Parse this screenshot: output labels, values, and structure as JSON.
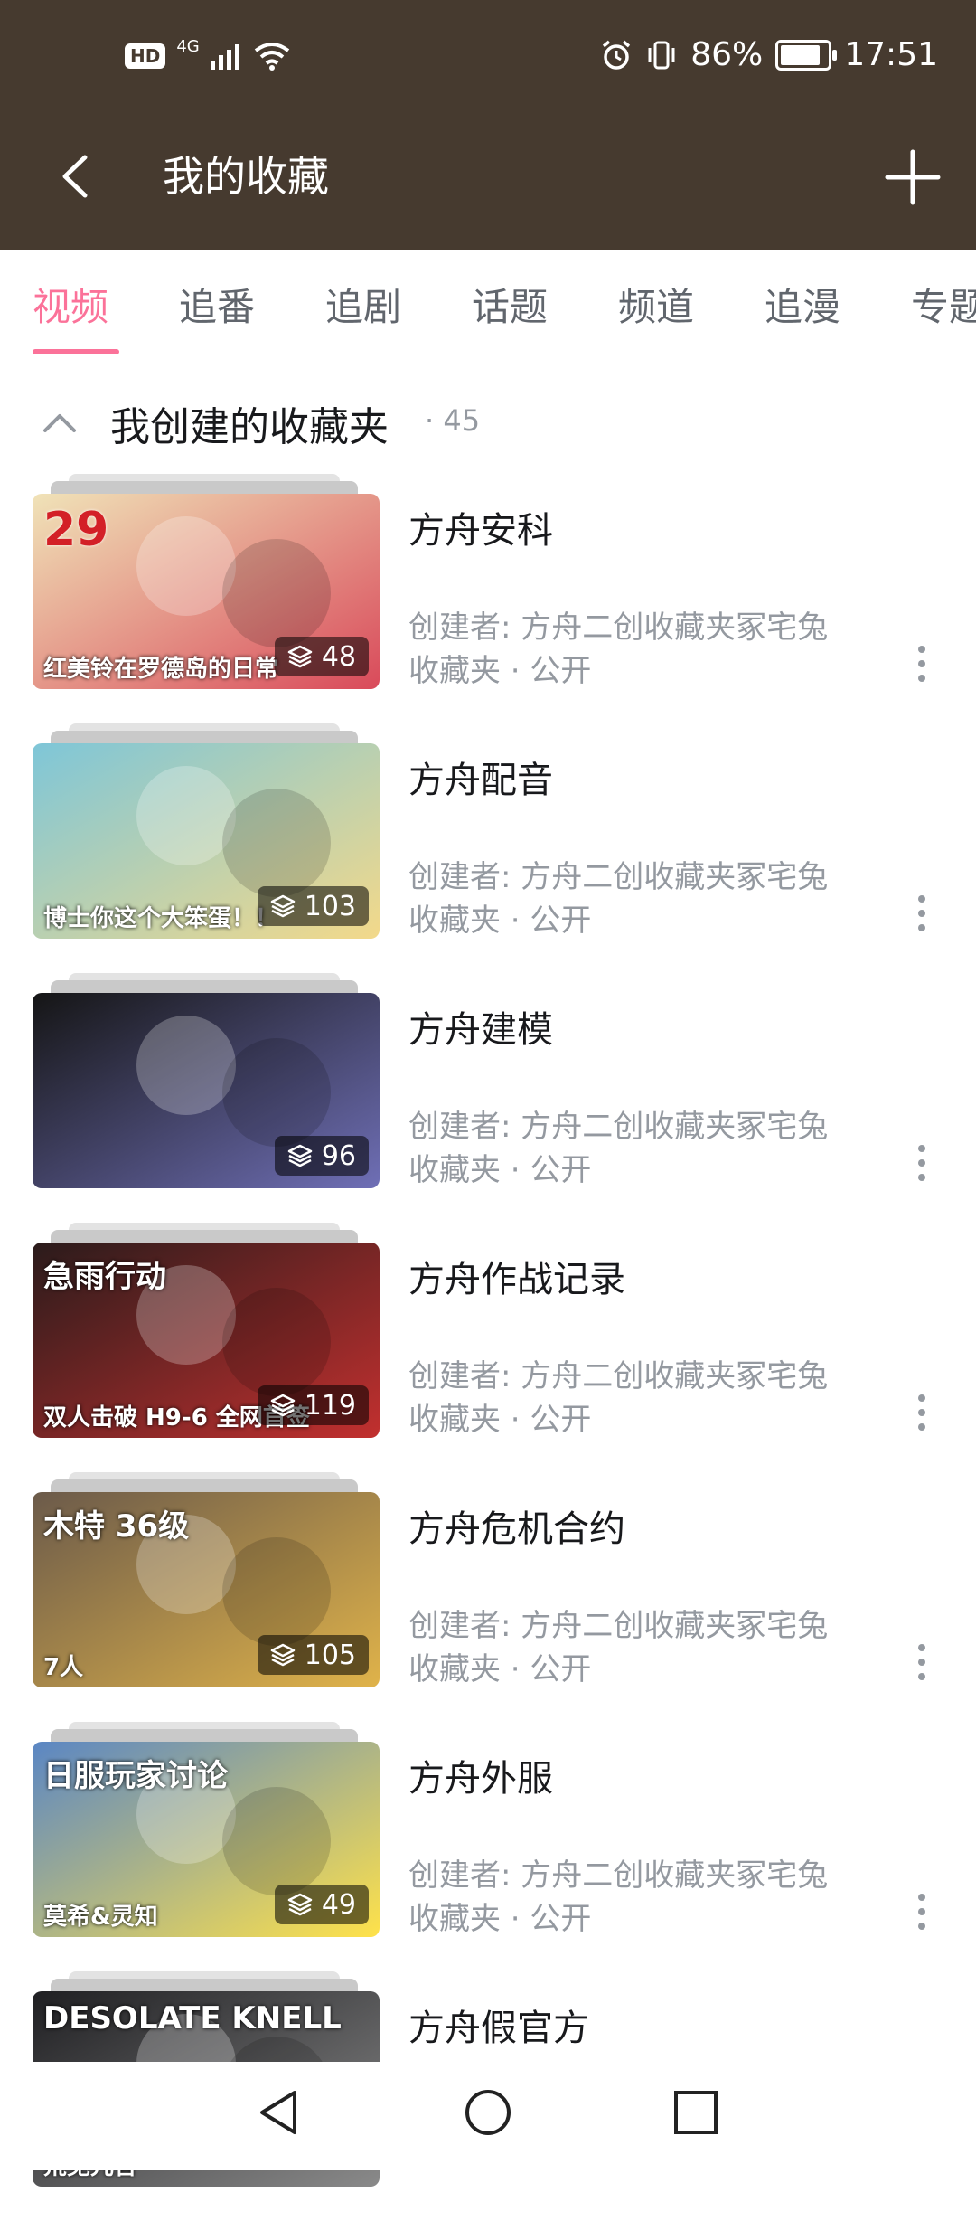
{
  "status": {
    "hd": "HD",
    "network": "4G",
    "battery_pct": "86%",
    "battery_level": 0.86,
    "time": "17:51"
  },
  "appbar": {
    "title": "我的收藏"
  },
  "tabs": [
    {
      "label": "视频",
      "active": true
    },
    {
      "label": "追番"
    },
    {
      "label": "追剧"
    },
    {
      "label": "话题"
    },
    {
      "label": "频道"
    },
    {
      "label": "追漫"
    },
    {
      "label": "专题"
    }
  ],
  "section": {
    "title": "我创建的收藏夹",
    "count": "· 45"
  },
  "folders": [
    {
      "title": "方舟安科",
      "creator": "创建者: 方舟二创收藏夹冢宅兔",
      "meta": "收藏夹 · 公开",
      "count": "48",
      "thumb_text_1": "29",
      "thumb_text_2": "红美铃在罗德岛的日常",
      "thumb_colors": [
        "#f0e3b8",
        "#d94a5a"
      ]
    },
    {
      "title": "方舟配音",
      "creator": "创建者: 方舟二创收藏夹冢宅兔",
      "meta": "收藏夹 · 公开",
      "count": "103",
      "thumb_text_1": "",
      "thumb_text_2": "博士你这个大笨蛋！！",
      "thumb_colors": [
        "#7ec6d8",
        "#f3d98a"
      ]
    },
    {
      "title": "方舟建模",
      "creator": "创建者: 方舟二创收藏夹冢宅兔",
      "meta": "收藏夹 · 公开",
      "count": "96",
      "thumb_text_1": "",
      "thumb_text_2": "",
      "thumb_colors": [
        "#151515",
        "#6f6fb6"
      ]
    },
    {
      "title": "方舟作战记录",
      "creator": "创建者: 方舟二创收藏夹冢宅兔",
      "meta": "收藏夹 · 公开",
      "count": "119",
      "thumb_text_1": "急雨行动",
      "thumb_text_2": "双人击破 H9-6 全网首签",
      "thumb_colors": [
        "#2a1b1b",
        "#c2302f"
      ]
    },
    {
      "title": "方舟危机合约",
      "creator": "创建者: 方舟二创收藏夹冢宅兔",
      "meta": "收藏夹 · 公开",
      "count": "105",
      "thumb_text_1": "木特 36级",
      "thumb_text_2": "7人",
      "thumb_colors": [
        "#6b5a4a",
        "#e0b34a"
      ]
    },
    {
      "title": "方舟外服",
      "creator": "创建者: 方舟二创收藏夹冢宅兔",
      "meta": "收藏夹 · 公开",
      "count": "49",
      "thumb_text_1": "日服玩家讨论",
      "thumb_text_2": "莫希&灵知",
      "thumb_colors": [
        "#5a86c4",
        "#ffe24a"
      ]
    },
    {
      "title": "方舟假官方",
      "creator": "",
      "meta": "",
      "count": "",
      "thumb_text_1": "DESOLATE KNELL",
      "thumb_text_2": "荒芜咒言",
      "thumb_colors": [
        "#1f1f22",
        "#8a8a8a"
      ]
    }
  ],
  "icons": {
    "back": "chevron-left-icon",
    "add": "plus-icon",
    "collapse": "chevron-up-icon",
    "count": "layers-icon",
    "more": "more-vertical-icon",
    "nav_back": "triangle-back-icon",
    "nav_home": "circle-home-icon",
    "nav_recent": "square-recent-icon"
  }
}
